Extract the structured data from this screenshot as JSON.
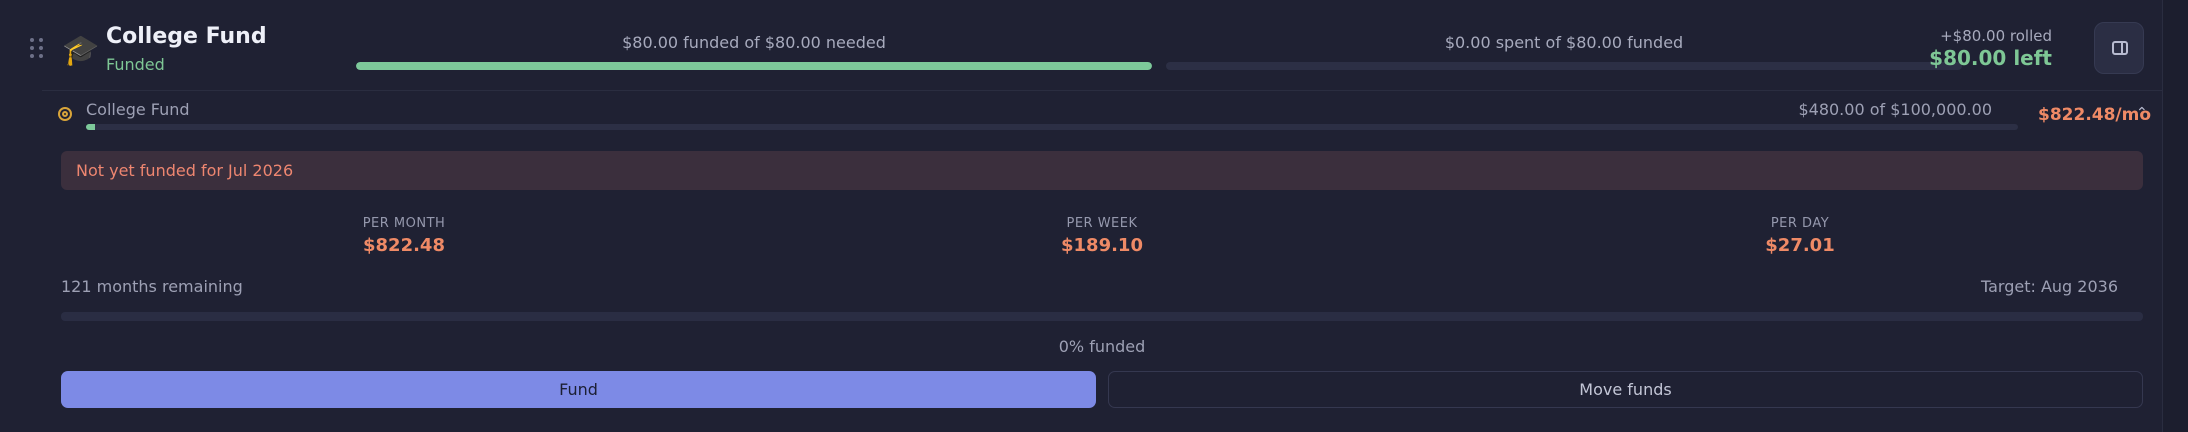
{
  "header": {
    "icon": "graduation-cap-icon",
    "title": "College Fund",
    "status": "Funded",
    "funded_text": "$80.00 funded of $80.00 needed",
    "funded_progress": 1.0,
    "spent_text": "$0.00 spent of $80.00 funded",
    "spent_progress": 0.0,
    "rolled": "+$80.00 rolled",
    "left": "$80.00 left",
    "side_panel_icon": "side-panel-icon"
  },
  "goal": {
    "icon": "target-icon",
    "name": "College Fund",
    "progress_text": "$480.00 of $100,000.00",
    "progress": 0.0048,
    "monthly": "$822.48/mo",
    "collapse_icon": "chevron-up-icon"
  },
  "alert": {
    "text": "Not yet funded for Jul 2026"
  },
  "stats": [
    {
      "label": "PER MONTH",
      "value": "$822.48"
    },
    {
      "label": "PER WEEK",
      "value": "$189.10"
    },
    {
      "label": "PER DAY",
      "value": "$27.01"
    }
  ],
  "remaining": "121 months remaining",
  "target": "Target: Aug 2036",
  "percent_funded": 0,
  "percent_text": "0% funded",
  "buttons": {
    "fund": "Fund",
    "move": "Move funds"
  },
  "colors": {
    "accent": "#7d8ae6",
    "positive": "#7ec795",
    "warning": "#ef8a66",
    "background": "#1f2133"
  }
}
